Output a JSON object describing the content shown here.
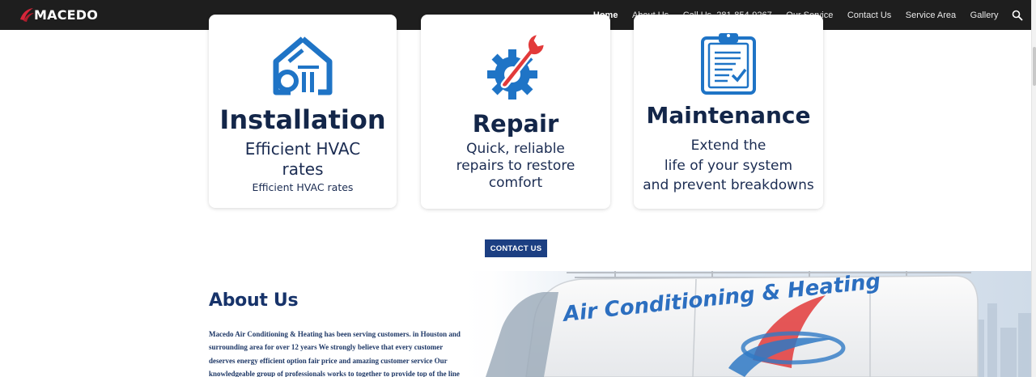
{
  "brand": {
    "name": "MACEDO",
    "accent": "#d6263a"
  },
  "nav": {
    "items": [
      {
        "label": "Home",
        "active": true
      },
      {
        "label": "About Us",
        "active": false
      },
      {
        "label": "Call Us. 281-854-9267",
        "active": false
      },
      {
        "label": "Our Service",
        "active": false
      },
      {
        "label": "Contact Us",
        "active": false
      },
      {
        "label": "Service Area",
        "active": false
      },
      {
        "label": "Gallery",
        "active": false
      }
    ],
    "search_icon": "search-icon"
  },
  "services": [
    {
      "icon": "house-icon",
      "title": "Installation",
      "desc_lines": [
        "Efficient HVAC",
        "rates"
      ],
      "sub": "Efficient HVAC rates"
    },
    {
      "icon": "wrench-gear-icon",
      "title": "Repair",
      "desc_lines": [
        "Quick, reliable",
        "repairs to restore",
        "comfort"
      ]
    },
    {
      "icon": "clipboard-icon",
      "title": "Maintenance",
      "desc_lines": [
        "Extend the",
        "life of your system",
        "and prevent breakdowns"
      ]
    }
  ],
  "contact_button": "CONTACT US",
  "about": {
    "heading": "About Us",
    "body_lines": [
      "Macedo Air Conditioning & Heating has been serving customers. in Houston and",
      "surrounding area for over 12 years We strongly believe that every customer",
      "deserves energy efficient option fair price and amazing customer service Our",
      "knowledgeable group of professionals works to together to provide top of the line"
    ],
    "van_text": "Air Conditioning & Heating"
  },
  "colors": {
    "navy": "#17336a",
    "button": "#1c3f82",
    "icon_blue": "#1f74c6",
    "icon_red": "#e23a3a"
  }
}
